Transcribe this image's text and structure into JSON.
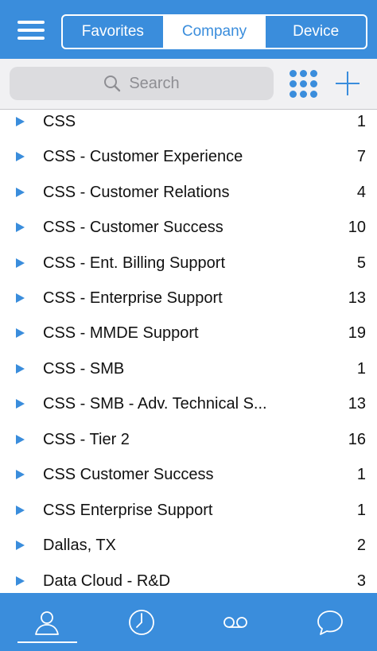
{
  "header": {
    "menu_icon": "hamburger-menu-icon",
    "tabs": [
      {
        "label": "Favorites",
        "active": false
      },
      {
        "label": "Company",
        "active": true
      },
      {
        "label": "Device",
        "active": false
      }
    ]
  },
  "search": {
    "placeholder": "Search",
    "icon": "search-icon",
    "grid_icon": "dial-pad-icon",
    "add_icon": "plus-icon"
  },
  "list": {
    "items": [
      {
        "name": "CSS",
        "count": "1"
      },
      {
        "name": "CSS - Customer Experience",
        "count": "7"
      },
      {
        "name": "CSS - Customer Relations",
        "count": "4"
      },
      {
        "name": "CSS - Customer Success",
        "count": "10"
      },
      {
        "name": "CSS - Ent. Billing Support",
        "count": "5"
      },
      {
        "name": "CSS - Enterprise Support",
        "count": "13"
      },
      {
        "name": "CSS - MMDE Support",
        "count": "19"
      },
      {
        "name": "CSS - SMB",
        "count": "1"
      },
      {
        "name": "CSS - SMB - Adv. Technical S...",
        "count": "13"
      },
      {
        "name": "CSS - Tier 2",
        "count": "16"
      },
      {
        "name": "CSS Customer Success",
        "count": "1"
      },
      {
        "name": "CSS Enterprise Support",
        "count": "1"
      },
      {
        "name": "Dallas, TX",
        "count": "2"
      },
      {
        "name": "Data Cloud - R&D",
        "count": "3"
      }
    ]
  },
  "tabbar": {
    "tabs": [
      {
        "icon": "contacts-icon",
        "active": true
      },
      {
        "icon": "clock-icon",
        "active": false
      },
      {
        "icon": "voicemail-icon",
        "active": false
      },
      {
        "icon": "chat-bubble-icon",
        "active": false
      }
    ]
  },
  "colors": {
    "accent": "#3a8ddc",
    "search_bg": "#dcdcdf",
    "toolbar_bg": "#f1f1f3"
  }
}
